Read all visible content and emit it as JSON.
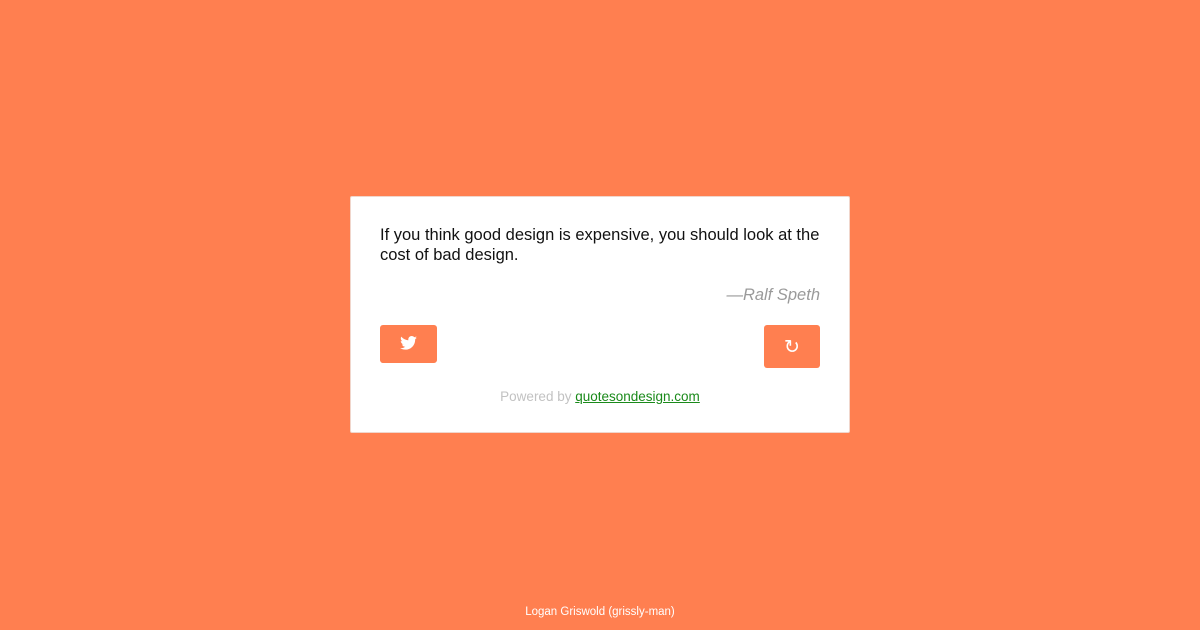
{
  "colors": {
    "background": "#ff7f50",
    "card": "#ffffff",
    "accent": "#ff7f50",
    "link": "#1a8a1a",
    "author": "#9a9a9a"
  },
  "quote": {
    "text": "If you think good design is expensive, you should look at the cost of bad design.",
    "author": "—Ralf Speth"
  },
  "actions": {
    "tweet_icon": "twitter-bird-icon",
    "new_quote_icon": "refresh-icon",
    "new_quote_glyph": "↻"
  },
  "credit": {
    "prefix": "Powered by ",
    "link_text": "quotesondesign.com"
  },
  "footer": {
    "text": "Logan Griswold (grissly-man)"
  }
}
